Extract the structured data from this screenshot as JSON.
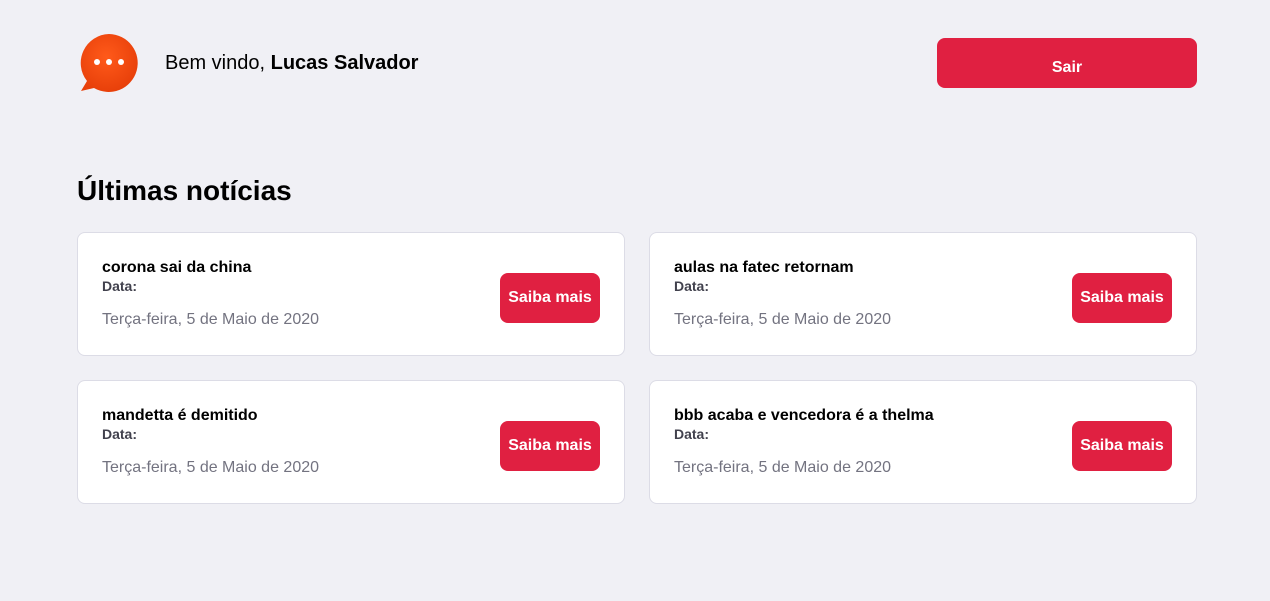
{
  "header": {
    "logo_icon": "chat-bubble-icon",
    "welcome_prefix": "Bem vindo,",
    "user_name": "Lucas Salvador",
    "logout_label": "Sair"
  },
  "section_title": "Últimas notícias",
  "news": [
    {
      "title": "corona sai da china",
      "date_label": "Data:",
      "date": "Terça-feira, 5 de Maio de 2020",
      "button": "Saiba mais"
    },
    {
      "title": "aulas na fatec retornam",
      "date_label": "Data:",
      "date": "Terça-feira, 5 de Maio de 2020",
      "button": "Saiba mais"
    },
    {
      "title": "mandetta é demitido",
      "date_label": "Data:",
      "date": "Terça-feira, 5 de Maio de 2020",
      "button": "Saiba mais"
    },
    {
      "title": "bbb acaba e vencedora é a thelma",
      "date_label": "Data:",
      "date": "Terça-feira, 5 de Maio de 2020",
      "button": "Saiba mais"
    }
  ],
  "colors": {
    "background": "#f0f0f5",
    "accent": "#e02041",
    "logo": "#f24e0f"
  }
}
